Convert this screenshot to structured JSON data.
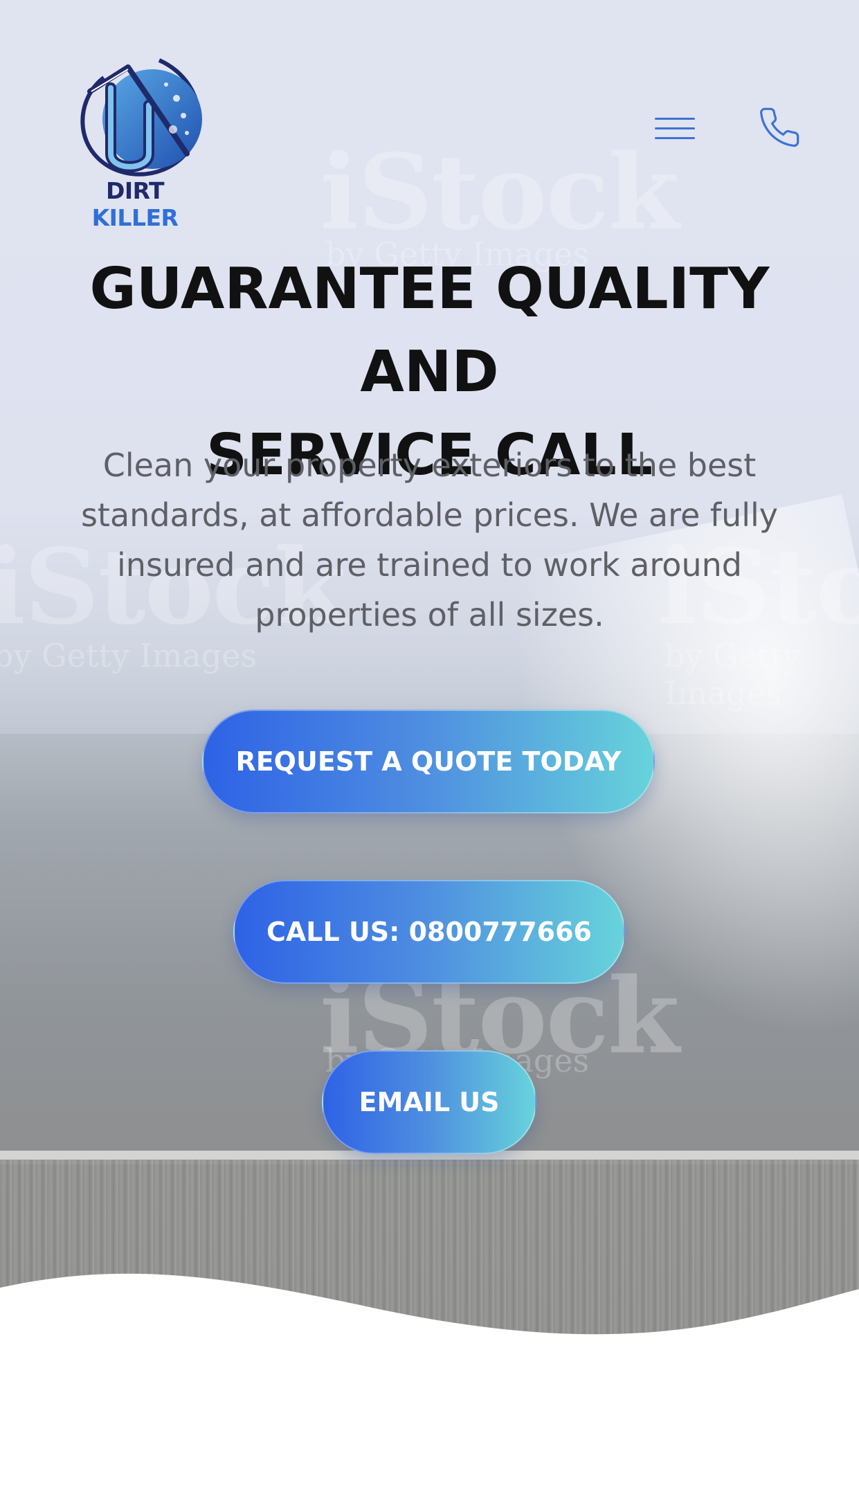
{
  "brand": {
    "logo_word_1": "DIRT",
    "logo_word_2": "KILLER",
    "colors": {
      "navy": "#1f2a6b",
      "blue": "#2f6fd8",
      "gradient_start": "#2e62e6",
      "gradient_end": "#67d3db"
    }
  },
  "header": {
    "menu_icon": "hamburger-menu-icon",
    "phone_icon": "phone-icon"
  },
  "hero": {
    "headline_line_1": "GUARANTEE QUALITY AND",
    "headline_line_2": "SERVICE CALL",
    "subtitle": "Clean your property exteriors to the best standards, at affordable prices. We are fully insured and are trained to work around properties of all sizes.",
    "background_watermark": "iStock",
    "background_watermark_sub": "by Getty Images"
  },
  "actions": {
    "quote_label": "REQUEST A QUOTE TODAY",
    "call_label": "CALL US: 0800777666",
    "email_label": "EMAIL US"
  }
}
